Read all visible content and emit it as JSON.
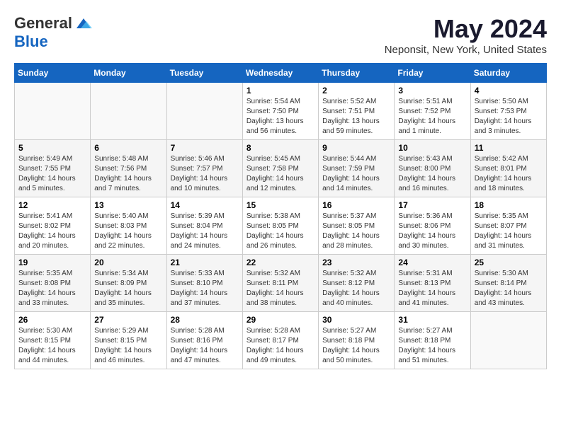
{
  "header": {
    "logo_general": "General",
    "logo_blue": "Blue",
    "month_title": "May 2024",
    "location": "Neponsit, New York, United States"
  },
  "weekdays": [
    "Sunday",
    "Monday",
    "Tuesday",
    "Wednesday",
    "Thursday",
    "Friday",
    "Saturday"
  ],
  "weeks": [
    [
      {
        "day": "",
        "info": ""
      },
      {
        "day": "",
        "info": ""
      },
      {
        "day": "",
        "info": ""
      },
      {
        "day": "1",
        "info": "Sunrise: 5:54 AM\nSunset: 7:50 PM\nDaylight: 13 hours\nand 56 minutes."
      },
      {
        "day": "2",
        "info": "Sunrise: 5:52 AM\nSunset: 7:51 PM\nDaylight: 13 hours\nand 59 minutes."
      },
      {
        "day": "3",
        "info": "Sunrise: 5:51 AM\nSunset: 7:52 PM\nDaylight: 14 hours\nand 1 minute."
      },
      {
        "day": "4",
        "info": "Sunrise: 5:50 AM\nSunset: 7:53 PM\nDaylight: 14 hours\nand 3 minutes."
      }
    ],
    [
      {
        "day": "5",
        "info": "Sunrise: 5:49 AM\nSunset: 7:55 PM\nDaylight: 14 hours\nand 5 minutes."
      },
      {
        "day": "6",
        "info": "Sunrise: 5:48 AM\nSunset: 7:56 PM\nDaylight: 14 hours\nand 7 minutes."
      },
      {
        "day": "7",
        "info": "Sunrise: 5:46 AM\nSunset: 7:57 PM\nDaylight: 14 hours\nand 10 minutes."
      },
      {
        "day": "8",
        "info": "Sunrise: 5:45 AM\nSunset: 7:58 PM\nDaylight: 14 hours\nand 12 minutes."
      },
      {
        "day": "9",
        "info": "Sunrise: 5:44 AM\nSunset: 7:59 PM\nDaylight: 14 hours\nand 14 minutes."
      },
      {
        "day": "10",
        "info": "Sunrise: 5:43 AM\nSunset: 8:00 PM\nDaylight: 14 hours\nand 16 minutes."
      },
      {
        "day": "11",
        "info": "Sunrise: 5:42 AM\nSunset: 8:01 PM\nDaylight: 14 hours\nand 18 minutes."
      }
    ],
    [
      {
        "day": "12",
        "info": "Sunrise: 5:41 AM\nSunset: 8:02 PM\nDaylight: 14 hours\nand 20 minutes."
      },
      {
        "day": "13",
        "info": "Sunrise: 5:40 AM\nSunset: 8:03 PM\nDaylight: 14 hours\nand 22 minutes."
      },
      {
        "day": "14",
        "info": "Sunrise: 5:39 AM\nSunset: 8:04 PM\nDaylight: 14 hours\nand 24 minutes."
      },
      {
        "day": "15",
        "info": "Sunrise: 5:38 AM\nSunset: 8:05 PM\nDaylight: 14 hours\nand 26 minutes."
      },
      {
        "day": "16",
        "info": "Sunrise: 5:37 AM\nSunset: 8:05 PM\nDaylight: 14 hours\nand 28 minutes."
      },
      {
        "day": "17",
        "info": "Sunrise: 5:36 AM\nSunset: 8:06 PM\nDaylight: 14 hours\nand 30 minutes."
      },
      {
        "day": "18",
        "info": "Sunrise: 5:35 AM\nSunset: 8:07 PM\nDaylight: 14 hours\nand 31 minutes."
      }
    ],
    [
      {
        "day": "19",
        "info": "Sunrise: 5:35 AM\nSunset: 8:08 PM\nDaylight: 14 hours\nand 33 minutes."
      },
      {
        "day": "20",
        "info": "Sunrise: 5:34 AM\nSunset: 8:09 PM\nDaylight: 14 hours\nand 35 minutes."
      },
      {
        "day": "21",
        "info": "Sunrise: 5:33 AM\nSunset: 8:10 PM\nDaylight: 14 hours\nand 37 minutes."
      },
      {
        "day": "22",
        "info": "Sunrise: 5:32 AM\nSunset: 8:11 PM\nDaylight: 14 hours\nand 38 minutes."
      },
      {
        "day": "23",
        "info": "Sunrise: 5:32 AM\nSunset: 8:12 PM\nDaylight: 14 hours\nand 40 minutes."
      },
      {
        "day": "24",
        "info": "Sunrise: 5:31 AM\nSunset: 8:13 PM\nDaylight: 14 hours\nand 41 minutes."
      },
      {
        "day": "25",
        "info": "Sunrise: 5:30 AM\nSunset: 8:14 PM\nDaylight: 14 hours\nand 43 minutes."
      }
    ],
    [
      {
        "day": "26",
        "info": "Sunrise: 5:30 AM\nSunset: 8:15 PM\nDaylight: 14 hours\nand 44 minutes."
      },
      {
        "day": "27",
        "info": "Sunrise: 5:29 AM\nSunset: 8:15 PM\nDaylight: 14 hours\nand 46 minutes."
      },
      {
        "day": "28",
        "info": "Sunrise: 5:28 AM\nSunset: 8:16 PM\nDaylight: 14 hours\nand 47 minutes."
      },
      {
        "day": "29",
        "info": "Sunrise: 5:28 AM\nSunset: 8:17 PM\nDaylight: 14 hours\nand 49 minutes."
      },
      {
        "day": "30",
        "info": "Sunrise: 5:27 AM\nSunset: 8:18 PM\nDaylight: 14 hours\nand 50 minutes."
      },
      {
        "day": "31",
        "info": "Sunrise: 5:27 AM\nSunset: 8:18 PM\nDaylight: 14 hours\nand 51 minutes."
      },
      {
        "day": "",
        "info": ""
      }
    ]
  ]
}
